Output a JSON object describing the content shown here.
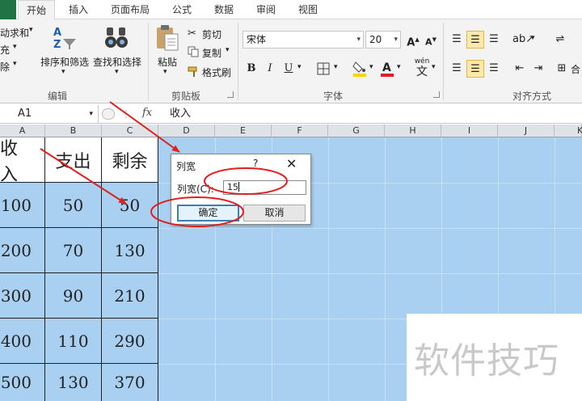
{
  "ribbon": {
    "tabs": [
      "开始",
      "插入",
      "页面布局",
      "公式",
      "数据",
      "审阅",
      "视图"
    ],
    "active_tab": "开始",
    "edit_group": {
      "autosum_label": "动求和",
      "fill_label": "充",
      "clear_label": "除",
      "sort_label": "排序和筛选",
      "find_label": "查找和选择",
      "group_label": "编辑"
    },
    "clipboard": {
      "paste_label": "粘贴",
      "cut_label": "剪切",
      "copy_label": "复制",
      "painter_label": "格式刷",
      "group_label": "剪贴板"
    },
    "font": {
      "font_name": "宋体",
      "font_size": "20",
      "grow_label": "A",
      "shrink_label": "A",
      "bold_label": "B",
      "italic_label": "I",
      "underline_label": "U",
      "phonetic_label": "wén",
      "phonetic_char": "文",
      "group_label": "字体"
    },
    "alignment": {
      "group_label": "对齐方式",
      "merge_label": "合"
    }
  },
  "formula_bar": {
    "name_box": "A1",
    "fx_label": "fx",
    "content": "收入"
  },
  "grid": {
    "column_headers": [
      "A",
      "B",
      "C",
      "D",
      "E",
      "F",
      "G",
      "H",
      "I",
      "J",
      "K"
    ],
    "table_header": [
      "收入",
      "支出",
      "剩余"
    ],
    "rows": [
      [
        "100",
        "50",
        "50"
      ],
      [
        "200",
        "70",
        "130"
      ],
      [
        "300",
        "90",
        "210"
      ],
      [
        "400",
        "110",
        "290"
      ],
      [
        "500",
        "130",
        "370"
      ]
    ]
  },
  "dialog": {
    "title": "列宽",
    "help": "?",
    "close": "✕",
    "field_label": "列宽(C):",
    "field_value": "15",
    "ok_label": "确定",
    "cancel_label": "取消"
  },
  "watermark_text": "软件技巧",
  "colors": {
    "sheet_fill": "#a9d0f0",
    "annotation_red": "#e02020",
    "excel_green": "#217346"
  }
}
